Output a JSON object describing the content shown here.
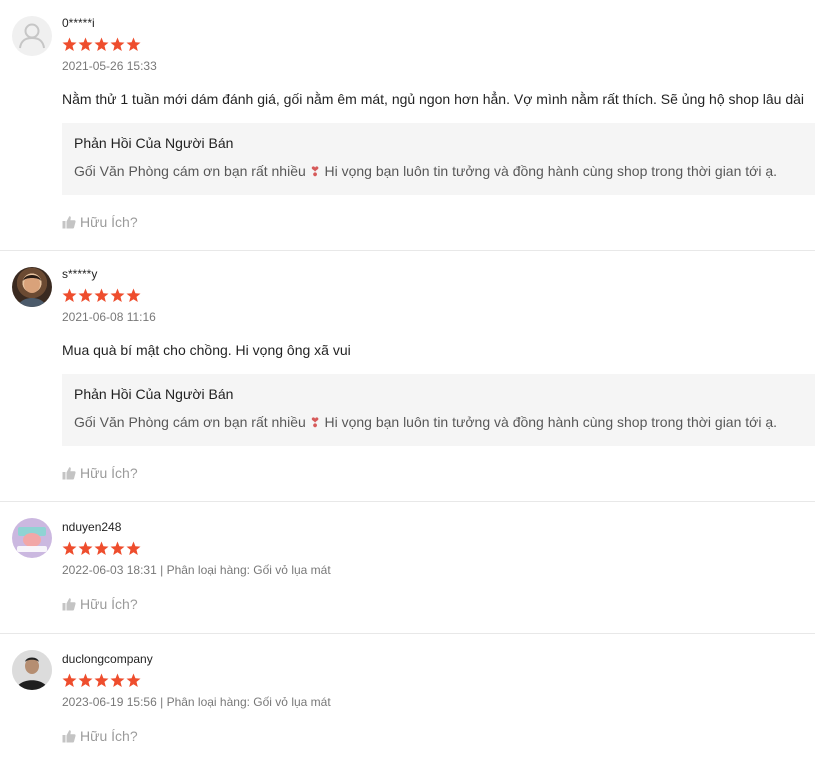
{
  "colors": {
    "star": "#ee4d2d",
    "reply_bg": "#f5f5f5",
    "divider": "#e5e5e5"
  },
  "reviews": [
    {
      "username": "0*****i",
      "rating": 5,
      "datetime": "2021-05-26 15:33",
      "variation": "",
      "content": "Nằm thử 1 tuần mới dám đánh giá, gối nằm êm mát, ngủ ngon hơn hẳn. Vợ mình nằm rất thích. Sẽ ủng hộ shop lâu dài",
      "reply_title": "Phản Hồi Của Người Bán",
      "reply_text_before": "Gối Văn Phòng cám ơn bạn rất nhiều",
      "reply_text_after": "Hi vọng bạn luôn tin tưởng và đồng hành cùng shop trong thời gian tới ạ.",
      "helpful_label": "Hữu Ích?",
      "avatar": "default-avatar-icon"
    },
    {
      "username": "s*****y",
      "rating": 5,
      "datetime": "2021-06-08 11:16",
      "variation": "",
      "content": "Mua quà bí mật cho chồng. Hi vọng ông xã vui",
      "reply_title": "Phản Hồi Của Người Bán",
      "reply_text_before": "Gối Văn Phòng cám ơn bạn rất nhiều",
      "reply_text_after": "Hi vọng bạn luôn tin tưởng và đồng hành cùng shop trong thời gian tới ạ.",
      "helpful_label": "Hữu Ích?",
      "avatar": "user-photo"
    },
    {
      "username": "nduyen248",
      "rating": 5,
      "datetime": "2022-06-03 18:31",
      "variation": "Phân loại hàng: Gối vỏ lụa mát",
      "separator": "|",
      "helpful_label": "Hữu Ích?",
      "avatar": "user-photo"
    },
    {
      "username": "duclongcompany",
      "rating": 5,
      "datetime": "2023-06-19 15:56",
      "variation": "Phân loại hàng: Gối vỏ lụa mát",
      "separator": "|",
      "helpful_label": "Hữu Ích?",
      "avatar": "user-photo"
    }
  ]
}
